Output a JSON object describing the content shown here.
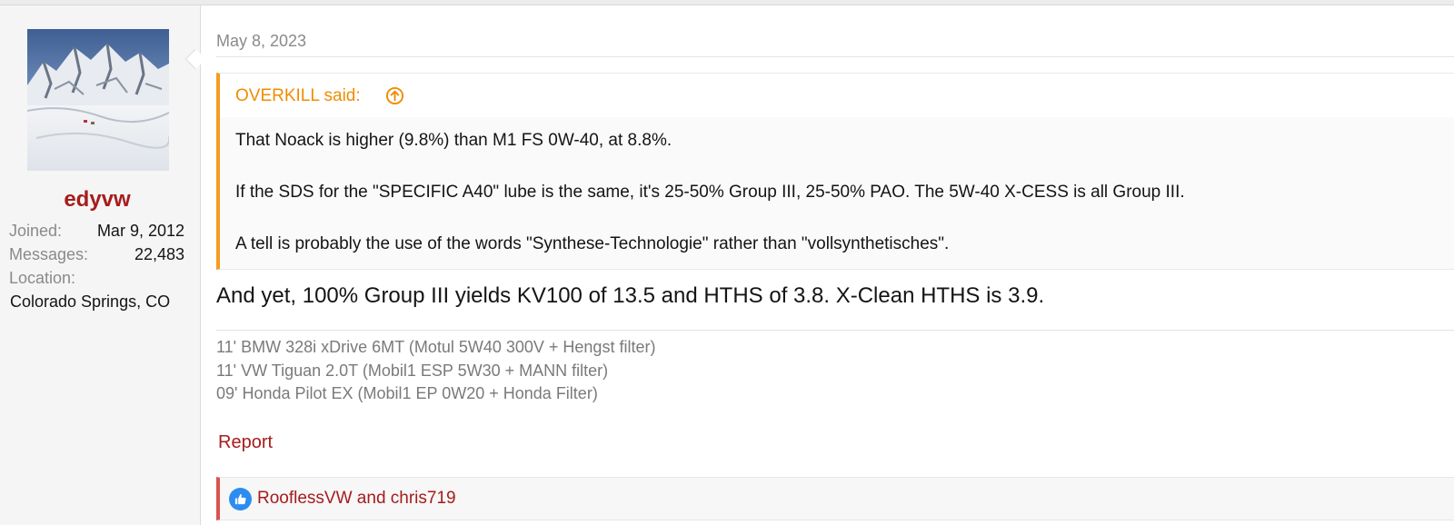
{
  "user": {
    "name": "edyvw",
    "avatar_icon": "user-avatar-mountain-photo",
    "stats": [
      {
        "label": "Joined:",
        "value": "Mar 9, 2012"
      },
      {
        "label": "Messages:",
        "value": "22,483"
      },
      {
        "label": "Location:",
        "value": ""
      }
    ],
    "location": "Colorado Springs, CO"
  },
  "post": {
    "date": "May 8, 2023",
    "quote": {
      "author": "OVERKILL said:",
      "jump_icon": "arrow-up-circle-icon",
      "lines": [
        "That Noack is higher (9.8%) than M1 FS 0W-40, at 8.8%.",
        "If the SDS for the \"SPECIFIC A40\" lube is the same, it's 25-50% Group III, 25-50% PAO. The 5W-40 X-CESS is all Group III.",
        "A tell is probably the use of the words \"Synthese-Technologie\" rather than \"vollsynthetisches\"."
      ]
    },
    "reply": "And yet, 100% Group III yields KV100 of 13.5 and HTHS of 3.8. X-Clean HTHS is 3.9.",
    "signature": [
      "11' BMW 328i xDrive 6MT (Motul 5W40 300V + Hengst filter)",
      "11' VW Tiguan 2.0T (Mobil1 ESP 5W30 + MANN filter)",
      "09' Honda Pilot EX (Mobil1 EP 0W20 + Honda Filter)"
    ],
    "report_label": "Report",
    "reactions": {
      "icon": "thumbs-up-icon",
      "text": "RooflessVW and chris719"
    }
  },
  "colors": {
    "username": "#a61c1c",
    "quote_accent": "#f59c20",
    "quote_author": "#f08c00",
    "link": "#a61c1c",
    "like_icon_bg": "#2d8cf0",
    "reactions_accent": "#d9534f"
  }
}
